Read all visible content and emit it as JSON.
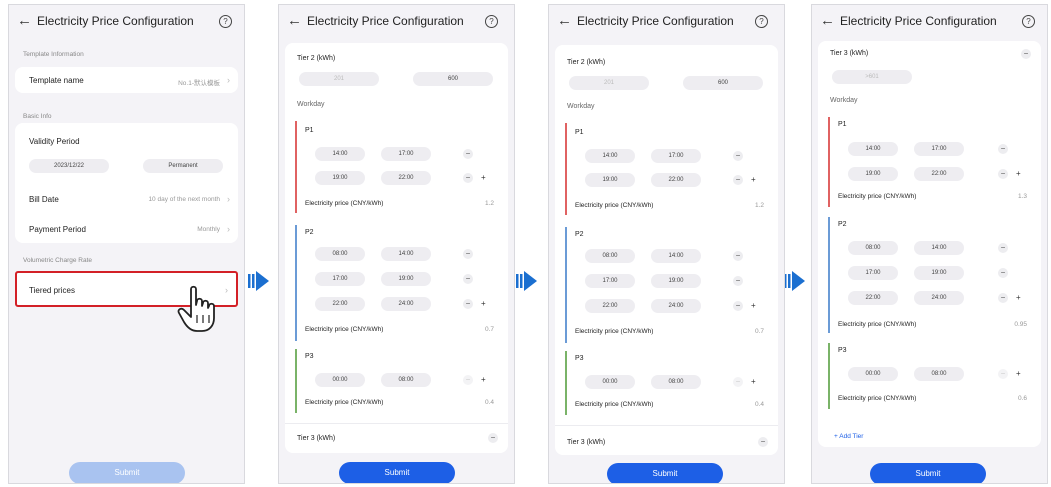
{
  "header": {
    "title": "Electricity Price Configuration",
    "back": "←",
    "help": "?"
  },
  "screen1": {
    "template_info": "Template Information",
    "template_name_label": "Template name",
    "template_name_value": "No.1-默认模板",
    "basic_info": "Basic Info",
    "validity_label": "Validity Period",
    "validity_start": "2023/12/22",
    "validity_end": "Permanent",
    "bill_date_label": "Bill Date",
    "bill_date_value": "10 day of the next month",
    "payment_label": "Payment Period",
    "payment_value": "Monthly",
    "volumetric": "Volumetric Charge Rate",
    "tiered": "Tiered prices",
    "submit": "Submit"
  },
  "tier2": {
    "label": "Tier 2 (kWh)",
    "from": "201",
    "to": "600"
  },
  "tier3": {
    "label": "Tier 3 (kWh)",
    "from": ">601"
  },
  "workday": "Workday",
  "periods": {
    "p1": {
      "label": "P1",
      "rows": [
        [
          "14:00",
          "17:00"
        ],
        [
          "19:00",
          "22:00"
        ]
      ],
      "price_label": "Electricity price (CNY/kWh)",
      "price": "1.2",
      "price_v4": "1.3"
    },
    "p2": {
      "label": "P2",
      "rows": [
        [
          "08:00",
          "14:00"
        ],
        [
          "17:00",
          "19:00"
        ],
        [
          "22:00",
          "24:00"
        ]
      ],
      "price_label": "Electricity price (CNY/kWh)",
      "price": "0.7",
      "price_v4": "0.95"
    },
    "p3": {
      "label": "P3",
      "rows": [
        [
          "00:00",
          "08:00"
        ]
      ],
      "price_label": "Electricity price (CNY/kWh)",
      "price": "0.4",
      "price_v4": "0.6"
    }
  },
  "add_tier": "+ Add Tier",
  "submit": "Submit",
  "colors": {
    "accent": "#1d5fe6",
    "p1": "#e06262",
    "p2": "#6b9bd6",
    "p3": "#7ab368",
    "highlight": "#d32027"
  }
}
